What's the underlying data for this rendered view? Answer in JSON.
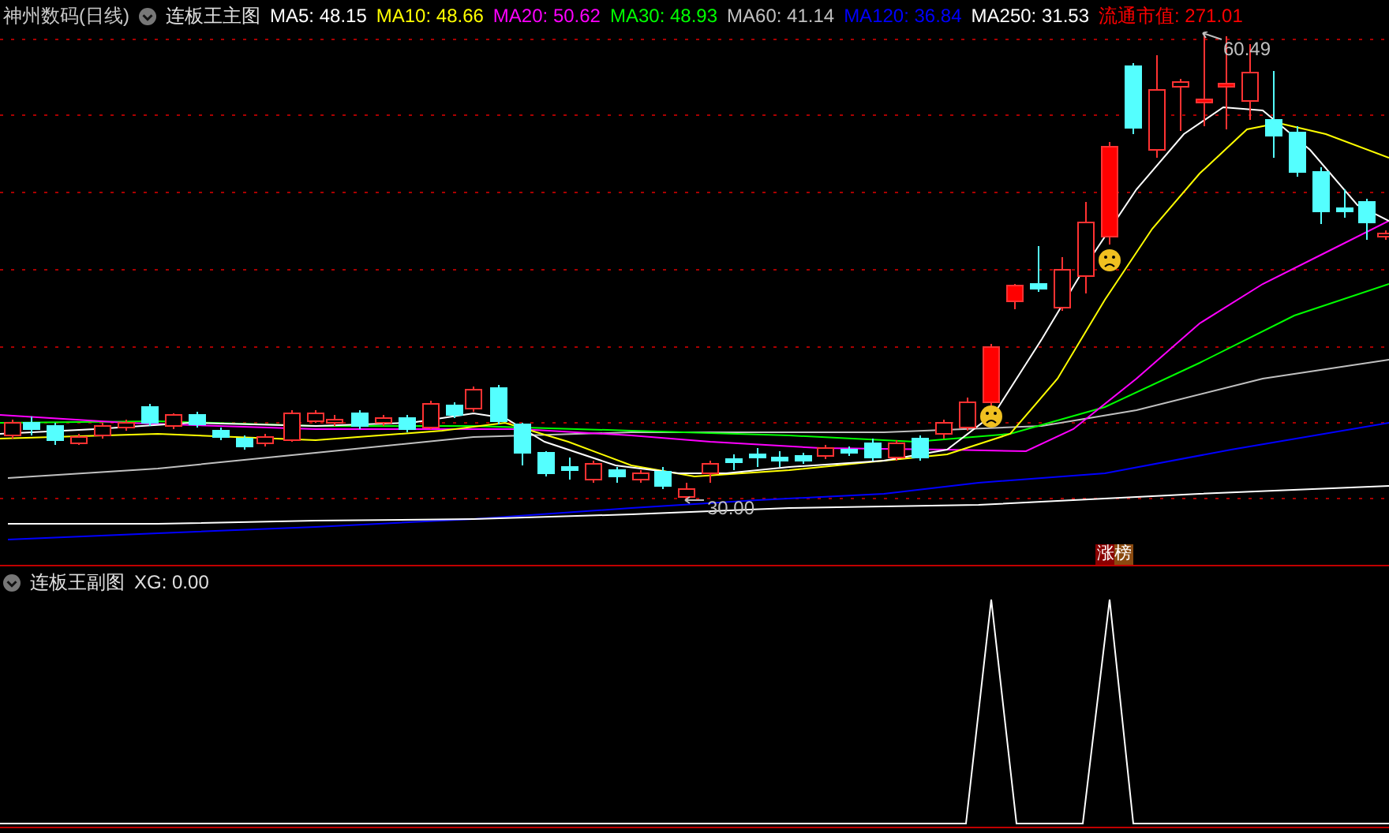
{
  "header": {
    "stock": "神州数码(日线)",
    "indicator": "连板王主图",
    "values": [
      {
        "text": "MA5: 48.15",
        "color": "#ffffff"
      },
      {
        "text": "MA10: 48.66",
        "color": "#ffff00"
      },
      {
        "text": "MA20: 50.62",
        "color": "#ff00ff"
      },
      {
        "text": "MA30: 48.93",
        "color": "#00ff00"
      },
      {
        "text": "MA60: 41.14",
        "color": "#c0c0c0"
      },
      {
        "text": "MA120: 36.84",
        "color": "#0000ff"
      },
      {
        "text": "MA250: 31.53",
        "color": "#ffffff"
      },
      {
        "text": "流通市值: 271.01",
        "color": "#ff0000"
      }
    ]
  },
  "main_chart": {
    "high_marker": "60.49",
    "low_marker": "30.00",
    "badge": "涨榜"
  },
  "sub_chart": {
    "indicator": "连板王副图",
    "value": "XG: 0.00"
  }
}
